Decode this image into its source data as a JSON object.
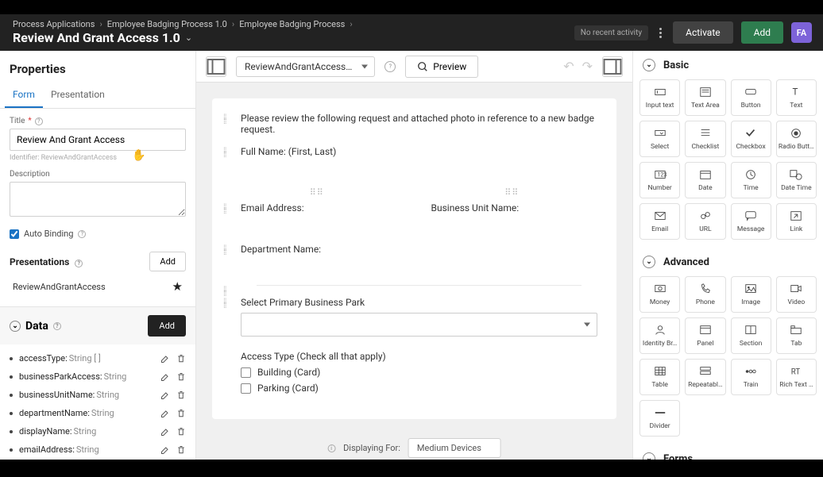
{
  "breadcrumbs": [
    "Process Applications",
    "Employee Badging Process 1.0",
    "Employee Badging Process"
  ],
  "page_title": "Review And Grant Access 1.0",
  "top": {
    "recent": "No recent activity",
    "activate": "Activate",
    "add": "Add",
    "avatar": "FA"
  },
  "left": {
    "header": "Properties",
    "tabs": [
      "Form",
      "Presentation"
    ],
    "title_label": "Title",
    "title_value": "Review And Grant Access",
    "identifier_label": "Identifier:",
    "identifier_value": "ReviewAndGrantAccess",
    "description_label": "Description",
    "auto_binding": "Auto Binding",
    "presentations_h": "Presentations",
    "add_btn": "Add",
    "presentation_item": "ReviewAndGrantAccess",
    "data_h": "Data",
    "data_items": [
      {
        "name": "accessType",
        "type": "String [ ]"
      },
      {
        "name": "businessParkAccess",
        "type": "String"
      },
      {
        "name": "businessUnitName",
        "type": "String"
      },
      {
        "name": "departmentName",
        "type": "String"
      },
      {
        "name": "displayName",
        "type": "String"
      },
      {
        "name": "emailAddress",
        "type": "String"
      }
    ]
  },
  "canvas_toolbar": {
    "dropdown": "ReviewAndGrantAccess…",
    "preview": "Preview"
  },
  "canvas": {
    "intro": "Please review the following request and attached photo in reference to a new badge request.",
    "fullname": "Full Name: (First, Last)",
    "email": "Email Address:",
    "bunit": "Business Unit Name:",
    "dept": "Department Name:",
    "select_park": "Select Primary Business Park",
    "access_type": "Access Type (Check all that apply)",
    "opt1": "Building (Card)",
    "opt2": "Parking (Card)",
    "displaying": "Displaying For:",
    "device": "Medium Devices"
  },
  "right": {
    "basic_h": "Basic",
    "advanced_h": "Advanced",
    "forms_h": "Forms",
    "basic": [
      "Input text",
      "Text Area",
      "Button",
      "Text",
      "Select",
      "Checklist",
      "Checkbox",
      "Radio Butt…",
      "Number",
      "Date",
      "Time",
      "Date Time",
      "Email",
      "URL",
      "Message",
      "Link"
    ],
    "advanced": [
      "Money",
      "Phone",
      "Image",
      "Video",
      "Identity Br…",
      "Panel",
      "Section",
      "Tab",
      "Table",
      "Repeatabl…",
      "Train",
      "Rich Text …",
      "Divider"
    ]
  }
}
